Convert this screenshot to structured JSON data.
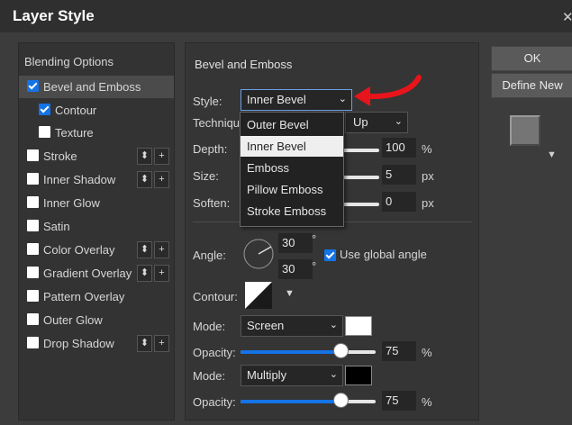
{
  "window": {
    "title": "Layer Style"
  },
  "left_panel": {
    "header": "Blending Options",
    "items": [
      {
        "label": "Bevel and Emboss",
        "checked": true,
        "selected": true
      },
      {
        "label": "Contour",
        "checked": true
      },
      {
        "label": "Texture",
        "checked": false
      },
      {
        "label": "Stroke",
        "checked": false
      },
      {
        "label": "Inner Shadow",
        "checked": false
      },
      {
        "label": "Inner Glow",
        "checked": false
      },
      {
        "label": "Satin",
        "checked": false
      },
      {
        "label": "Color Overlay",
        "checked": false
      },
      {
        "label": "Gradient Overlay",
        "checked": false
      },
      {
        "label": "Pattern Overlay",
        "checked": false
      },
      {
        "label": "Outer Glow",
        "checked": false
      },
      {
        "label": "Drop Shadow",
        "checked": false
      }
    ],
    "mini_up": "⬍",
    "mini_plus": "+"
  },
  "main": {
    "section_title": "Bevel and Emboss",
    "style_label": "Style:",
    "style_value": "Inner Bevel",
    "technique_label": "Techniqu",
    "direction_value": "Up",
    "depth_label": "Depth:",
    "depth_value": "100",
    "depth_unit": "%",
    "size_label": "Size:",
    "size_value": "5",
    "size_unit": "px",
    "soften_label": "Soften:",
    "soften_value": "0",
    "soften_unit": "px",
    "angle_label": "Angle:",
    "angle_value": "30",
    "altitude_value": "30",
    "degree": "°",
    "use_global_angle": "Use global angle",
    "contour_label": "Contour:",
    "highlight_mode_label": "Mode:",
    "highlight_mode": "Screen",
    "highlight_opacity_label": "Opacity:",
    "highlight_opacity": "75",
    "highlight_opacity_unit": "%",
    "shadow_mode_label": "Mode:",
    "shadow_mode": "Multiply",
    "shadow_opacity_label": "Opacity:",
    "shadow_opacity": "75",
    "shadow_opacity_unit": "%"
  },
  "dropdown": {
    "options": [
      "Outer Bevel",
      "Inner Bevel",
      "Emboss",
      "Pillow Emboss",
      "Stroke Emboss"
    ],
    "selected": "Inner Bevel"
  },
  "buttons": {
    "ok": "OK",
    "define_new": "Define New"
  },
  "colors": {
    "accent": "#1473e6",
    "annotation_arrow": "#e8141b",
    "highlight_color": "#ffffff",
    "shadow_color": "#000000"
  },
  "icons": {
    "close": "close-icon",
    "chevron": "chevron-down-icon",
    "check": "checkmark-icon",
    "updown": "up-down-arrows-icon",
    "plus": "plus-icon"
  }
}
